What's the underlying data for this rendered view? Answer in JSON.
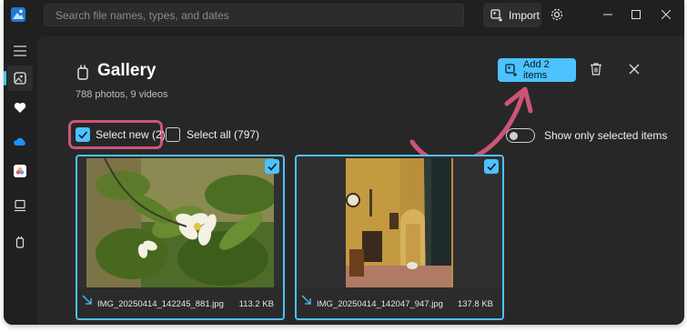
{
  "titlebar": {
    "search_placeholder": "Search file names, types, and dates",
    "import_label": "Import"
  },
  "gallery": {
    "title": "Gallery",
    "subtitle": "788 photos, 9 videos",
    "add_label": "Add 2 items"
  },
  "selection": {
    "select_new_label": "Select new (2)",
    "select_new_checked": true,
    "select_all_label": "Select all (797)",
    "select_all_checked": false,
    "show_only_selected_label": "Show only selected items",
    "show_only_selected_on": false
  },
  "items": [
    {
      "file_name": "IMG_20250414_142245_881.jpg",
      "size": "113.2 KB",
      "selected": true
    },
    {
      "file_name": "IMG_20250414_142047_947.jpg",
      "size": "137.8 KB",
      "selected": true
    }
  ],
  "colors": {
    "accent": "#4cc2ff",
    "highlight": "#cc5577",
    "background": "#202020",
    "panel": "#272727"
  },
  "icons": [
    "app-icon",
    "import-icon",
    "gear-icon",
    "minimize-icon",
    "maximize-icon",
    "close-icon",
    "menu-icon",
    "gallery-icon",
    "heart-icon",
    "onedrive-icon",
    "icloud-icon",
    "pc-icon",
    "phone-icon",
    "trash-icon",
    "checkmark-icon",
    "download-arrow-icon"
  ]
}
